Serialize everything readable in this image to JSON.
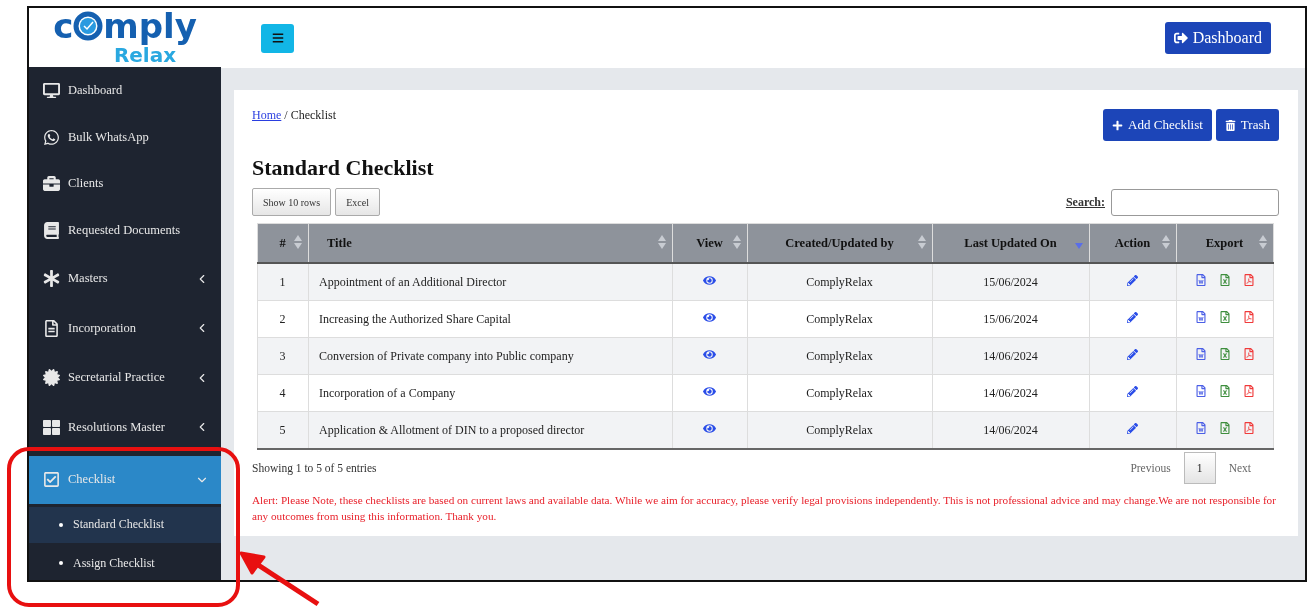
{
  "logo": {
    "before": "c",
    "after": "mply",
    "tagline": "Relax"
  },
  "topbar": {
    "button": "Dashboard"
  },
  "sidebar": {
    "items": [
      {
        "label": "Dashboard",
        "kind": "link",
        "selected": false
      },
      {
        "label": "Bulk WhatsApp",
        "kind": "link",
        "selected": false
      },
      {
        "label": "Clients",
        "kind": "link",
        "selected": false
      },
      {
        "label": "Requested Documents",
        "kind": "link",
        "selected": false
      },
      {
        "label": "Masters",
        "kind": "menu",
        "expanded": false,
        "selected": false
      },
      {
        "label": "Incorporation",
        "kind": "menu",
        "expanded": false,
        "selected": false
      },
      {
        "label": "Secretarial Practice",
        "kind": "menu",
        "expanded": false,
        "selected": false
      },
      {
        "label": "Resolutions Master",
        "kind": "menu",
        "expanded": false,
        "selected": false
      },
      {
        "label": "Checklist",
        "kind": "menu",
        "expanded": true,
        "selected": true,
        "children": [
          {
            "label": "Standard Checklist",
            "selected": true
          },
          {
            "label": "Assign Checklist",
            "selected": false
          }
        ]
      }
    ]
  },
  "breadcrumb": {
    "link": "Home",
    "separator": "/",
    "current": "Checklist"
  },
  "actions": [
    "Add Checklist",
    "Trash"
  ],
  "title": "Standard Checklist",
  "table_buttons": [
    "Show 10 rows",
    "Excel"
  ],
  "search": {
    "label": "Search:"
  },
  "table": {
    "columns": [
      {
        "label": "#",
        "sorted_descending": false
      },
      {
        "label": "Title",
        "sorted_descending": false
      },
      {
        "label": "View",
        "sorted_descending": false
      },
      {
        "label": "Created/Updated by",
        "sorted_descending": false
      },
      {
        "label": "Last Updated On",
        "sorted_descending": true
      },
      {
        "label": "Action",
        "sorted_descending": false
      },
      {
        "label": "Export",
        "sorted_descending": false
      }
    ],
    "rows": [
      {
        "number": "1",
        "title": "Appointment of an Additional Director",
        "created_by": "ComplyRelax",
        "updated_on": "15/06/2024"
      },
      {
        "number": "2",
        "title": "Increasing the Authorized Share Capital",
        "created_by": "ComplyRelax",
        "updated_on": "15/06/2024"
      },
      {
        "number": "3",
        "title": "Conversion of Private company into Public company",
        "created_by": "ComplyRelax",
        "updated_on": "14/06/2024"
      },
      {
        "number": "4",
        "title": "Incorporation of a Company",
        "created_by": "ComplyRelax",
        "updated_on": "14/06/2024"
      },
      {
        "number": "5",
        "title": "Application & Allotment of DIN to a proposed director",
        "created_by": "ComplyRelax",
        "updated_on": "14/06/2024"
      }
    ]
  },
  "info": "Showing 1 to 5 of 5 entries",
  "pagination": [
    {
      "label": "Previous",
      "kind": "nav",
      "disabled": true
    },
    {
      "label": "1",
      "kind": "page",
      "selected": true
    },
    {
      "label": "Next",
      "kind": "nav",
      "disabled": true
    }
  ],
  "alert": "Alert: Please Note, these checklists are based on current laws and available data. While we aim for accuracy, please verify legal provisions independently. This is not professional advice and may change.We are not responsible for any outcomes from using this information. Thank you."
}
